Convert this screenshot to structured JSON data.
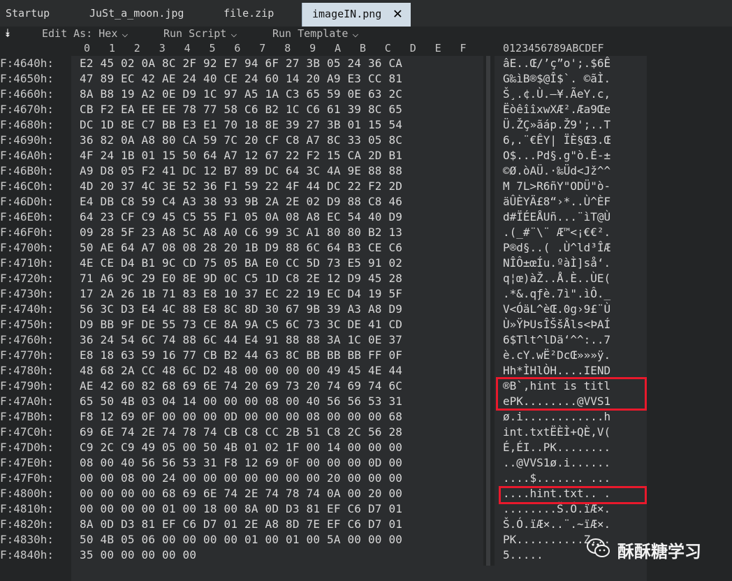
{
  "tabs": [
    {
      "label": "Startup"
    },
    {
      "label": "JuSt_a_moon.jpg"
    },
    {
      "label": "file.zip"
    },
    {
      "label": "imageIN.png",
      "active": true
    }
  ],
  "toolbar": {
    "edit_as": "Edit As: Hex",
    "run_script": "Run Script",
    "run_template": "Run Template"
  },
  "column_header": {
    "hex_cols": [
      "0",
      "1",
      "2",
      "3",
      "4",
      "5",
      "6",
      "7",
      "8",
      "9",
      "A",
      "B",
      "C",
      "D",
      "E",
      "F"
    ],
    "ascii_cols": "0123456789ABCDEF"
  },
  "rows": [
    {
      "addr": "F:4640h:",
      "hex": "E2 45 02 0A 8C 2F 92 E7 94 6F 27 3B 05 24 36 CA",
      "ascii": "âE..Œ/’ç”o';.$6Ê"
    },
    {
      "addr": "F:4650h:",
      "hex": "47 89 EC 42 AE 24 40 CE 24 60 14 20 A9 E3 CC 81",
      "ascii": "G‰ìB®$@Î$`. ©ãÌ."
    },
    {
      "addr": "F:4660h:",
      "hex": "8A B8 19 A2 0E D9 1C 97 A5 1A C3 65 59 0E 63 2C",
      "ascii": "Š¸.¢.Ù.—¥.ÃeY.c,"
    },
    {
      "addr": "F:4670h:",
      "hex": "CB F2 EA EE EE 78 77 58 C6 B2 1C C6 61 39 8C 65",
      "ascii": "ËòêîîxwXÆ².Æa9Œe"
    },
    {
      "addr": "F:4680h:",
      "hex": "DC 1D 8E C7 BB E3 E1 70 18 8E 39 27 3B 01 15 54",
      "ascii": "Ü.ŽÇ»ãáp.Ž9';..T"
    },
    {
      "addr": "F:4690h:",
      "hex": "36 82 0A A8 80 CA 59 7C 20 CF C8 A7 8C 33 05 8C",
      "ascii": "6‚.¨€ÊY| ÏÈ§Œ3.Œ"
    },
    {
      "addr": "F:46A0h:",
      "hex": "4F 24 1B 01 15 50 64 A7 12 67 22 F2 15 CA 2D B1",
      "ascii": "O$...Pd§.g\"ò.Ê-±"
    },
    {
      "addr": "F:46B0h:",
      "hex": "A9 D8 05 F2 41 DC 12 B7 89 DC 64 3C 4A 9E 88 88",
      "ascii": "©Ø.òAÜ.·‰Üd<Jž^^"
    },
    {
      "addr": "F:46C0h:",
      "hex": "4D 20 37 4C 3E 52 36 F1 59 22 4F 44 DC 22 F2 2D",
      "ascii": "M 7L>R6ñY\"ODÜ\"ò-"
    },
    {
      "addr": "F:46D0h:",
      "hex": "E4 DB C8 59 C4 A3 38 93 9B 2A 2E 02 D9 88 C8 46",
      "ascii": "äÛÈYÄ£8“›*..Ù^ÈF"
    },
    {
      "addr": "F:46E0h:",
      "hex": "64 23 CF C9 45 C5 55 F1 05 0A 08 A8 EC 54 40 D9",
      "ascii": "d#ÏÉEÅUñ...¨ìT@Ù"
    },
    {
      "addr": "F:46F0h:",
      "hex": "09 28 5F 23 A8 5C A8 A0 C6 99 3C A1 80 80 B2 13",
      "ascii": ".(_#¨\\¨ Æ™<¡€€²."
    },
    {
      "addr": "F:4700h:",
      "hex": "50 AE 64 A7 08 08 28 20 1B D9 88 6C 64 B3 CE C6",
      "ascii": "P®d§..( .Ù^ld³ÎÆ"
    },
    {
      "addr": "F:4710h:",
      "hex": "4E CE D4 B1 9C CD 75 05 BA E0 CC 5D 73 E5 91 02",
      "ascii": "NÎÔ±œÍu.ºàÌ]så‘."
    },
    {
      "addr": "F:4720h:",
      "hex": "71 A6 9C 29 E0 8E 9D 0C C5 1D C8 2E 12 D9 45 28",
      "ascii": "q¦œ)àŽ..Å.È..ÙE("
    },
    {
      "addr": "F:4730h:",
      "hex": "17 2A 26 1B 71 83 E8 10 37 EC 22 19 EC D4 19 5F",
      "ascii": ".*&.qƒè.7ì\".ìÔ._"
    },
    {
      "addr": "F:4740h:",
      "hex": "56 3C D3 E4 4C 88 E8 8C 8D 30 67 9B 39 A3 A8 D9",
      "ascii": "V<ÓäL^èŒ.0g›9£¨Ù"
    },
    {
      "addr": "F:4750h:",
      "hex": "D9 BB 9F DE 55 73 CE 8A 9A C5 6C 73 3C DE 41 CD",
      "ascii": "Ù»ŸÞUsÎŠšÅls<ÞAÍ"
    },
    {
      "addr": "F:4760h:",
      "hex": "36 24 54 6C 74 88 6C 44 E4 91 88 88 3A 1C 0E 37",
      "ascii": "6$Tlt^lDä‘^^:..7"
    },
    {
      "addr": "F:4770h:",
      "hex": "E8 18 63 59 16 77 CB B2 44 63 8C BB BB BB FF 0F",
      "ascii": "è.cY.wË²DcŒ»»»ÿ."
    },
    {
      "addr": "F:4780h:",
      "hex": "48 68 2A CC 48 6C D2 48 00 00 00 00 49 45 4E 44",
      "ascii": "Hh*ÌHlÒH....IEND"
    },
    {
      "addr": "F:4790h:",
      "hex": "AE 42 60 82 68 69 6E 74 20 69 73 20 74 69 74 6C",
      "ascii": "®B`‚hint is titl"
    },
    {
      "addr": "F:47A0h:",
      "hex": "65 50 4B 03 04 14 00 00 00 08 00 40 56 56 53 31",
      "ascii": "ePK........@VVS1"
    },
    {
      "addr": "F:47B0h:",
      "hex": "F8 12 69 0F 00 00 00 0D 00 00 00 08 00 00 00 68",
      "ascii": "ø.i............h"
    },
    {
      "addr": "F:47C0h:",
      "hex": "69 6E 74 2E 74 78 74 CB C8 CC 2B 51 C8 2C 56 28",
      "ascii": "int.txtËÈÌ+QÈ,V("
    },
    {
      "addr": "F:47D0h:",
      "hex": "C9 2C C9 49 05 00 50 4B 01 02 1F 00 14 00 00 00",
      "ascii": "É,ÉI..PK........"
    },
    {
      "addr": "F:47E0h:",
      "hex": "08 00 40 56 56 53 31 F8 12 69 0F 00 00 00 0D 00",
      "ascii": "..@VVS1ø.i......"
    },
    {
      "addr": "F:47F0h:",
      "hex": "00 00 08 00 24 00 00 00 00 00 00 00 20 00 00 00",
      "ascii": "....$....... ..."
    },
    {
      "addr": "F:4800h:",
      "hex": "00 00 00 00 68 69 6E 74 2E 74 78 74 0A 00 20 00",
      "ascii": "....hint.txt.. ."
    },
    {
      "addr": "F:4810h:",
      "hex": "00 00 00 00 01 00 18 00 8A 0D D3 81 EF C6 D7 01",
      "ascii": "........Š.Ó.ïÆ×."
    },
    {
      "addr": "F:4820h:",
      "hex": "8A 0D D3 81 EF C6 D7 01 2E A8 8D 7E EF C6 D7 01",
      "ascii": "Š.Ó.ïÆ×..¨.~ïÆ×."
    },
    {
      "addr": "F:4830h:",
      "hex": "50 4B 05 06 00 00 00 00 01 00 01 00 5A 00 00 00",
      "ascii": "PK..........Z..."
    },
    {
      "addr": "F:4840h:",
      "hex": "35 00 00 00 00 00",
      "ascii": "5....."
    }
  ],
  "watermark": {
    "text": "酥酥糖学习",
    "icon": "wechat-icon"
  },
  "colors": {
    "highlight": "#e8192c",
    "active_tab": "#d0dce6"
  }
}
